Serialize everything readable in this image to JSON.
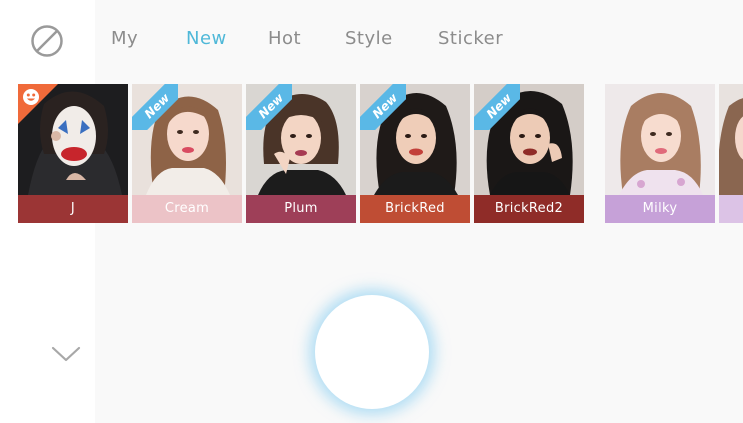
{
  "tabs": [
    {
      "label": "My",
      "active": false
    },
    {
      "label": "New",
      "active": true
    },
    {
      "label": "Hot",
      "active": false
    },
    {
      "label": "Style",
      "active": false
    },
    {
      "label": "Sticker",
      "active": false
    }
  ],
  "filters": [
    {
      "name": "J",
      "badge": "",
      "color": "#9b3535"
    },
    {
      "name": "Cream",
      "badge": "New",
      "color": "#ecc3c7"
    },
    {
      "name": "Plum",
      "badge": "New",
      "color": "#9e3f58"
    },
    {
      "name": "BrickRed",
      "badge": "New",
      "color": "#bf4d34"
    },
    {
      "name": "BrickRed2",
      "badge": "New",
      "color": "#8f2c28"
    },
    {
      "name": "Milky",
      "badge": "",
      "color": "#c6a1d8"
    }
  ],
  "colors": {
    "accent": "#4fb8d8",
    "tab_inactive": "#8c8c8c",
    "new_badge": "#5ab8e6",
    "j_badge": "#f06a3a"
  },
  "icons": {
    "none_filter": "no-filter-icon",
    "collapse": "chevron-down-icon",
    "j_badge": "smiley-face-icon"
  }
}
